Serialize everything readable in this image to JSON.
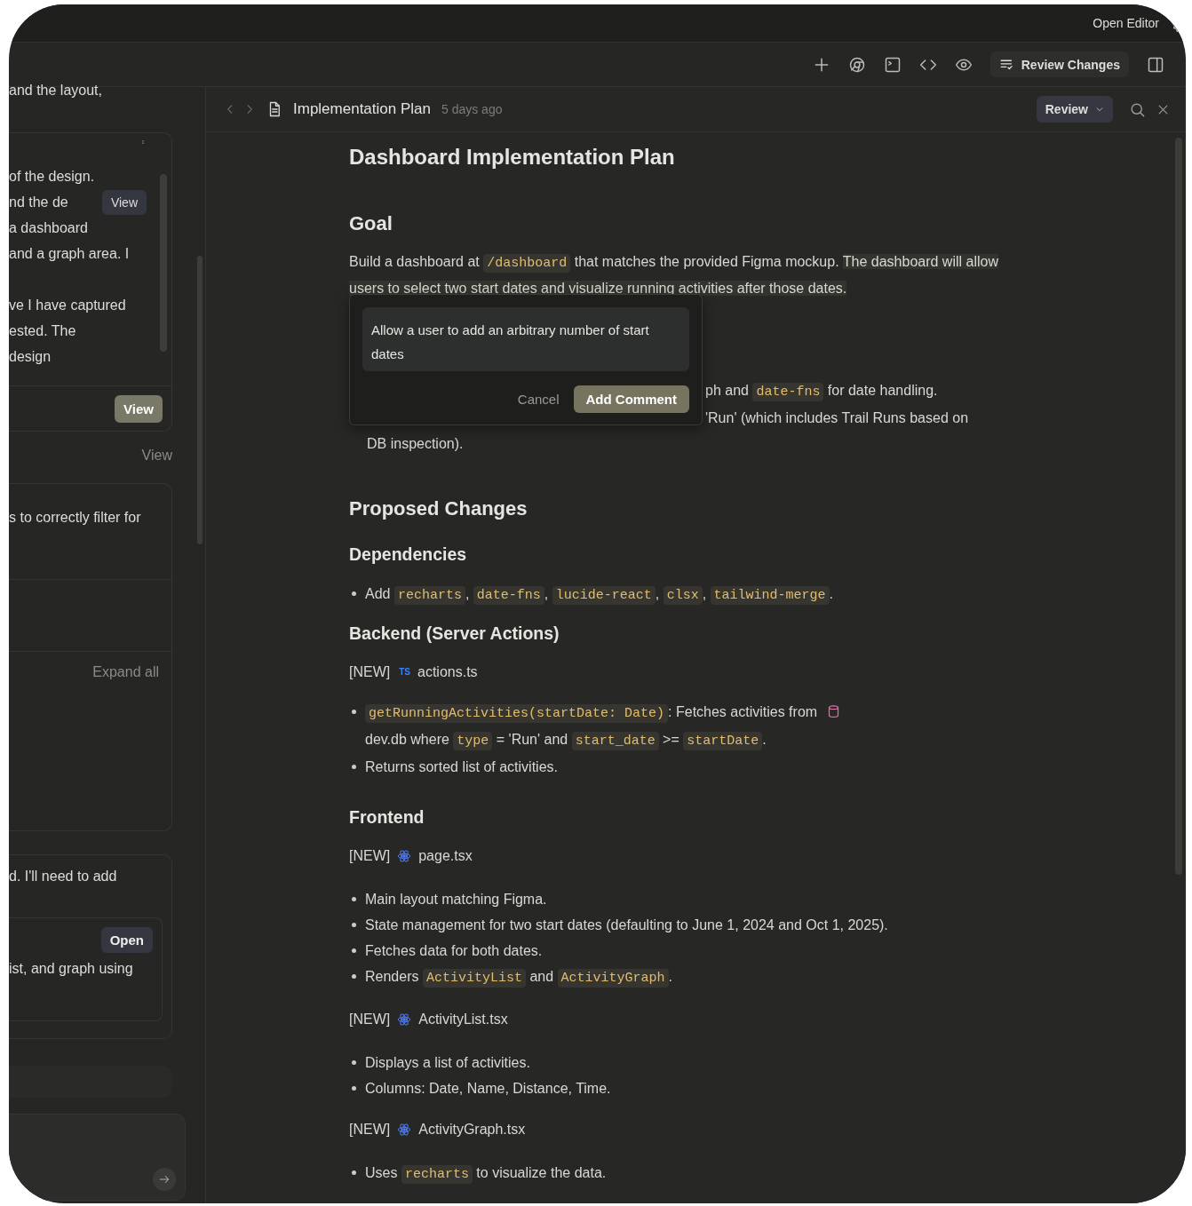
{
  "title_bar": {
    "open_editor": "Open Editor"
  },
  "toolbar": {
    "review_changes": "Review Changes"
  },
  "sidebar": {
    "top_text": "and the layout,",
    "card_lines": [
      {
        "text": "of the design."
      },
      {
        "text": "nd the de",
        "button": "View"
      },
      {
        "text": "a dashboard"
      },
      {
        "text": "and a graph area. I"
      },
      {
        "text": "ve I have captured"
      },
      {
        "text": "ested. The"
      },
      {
        "text": "design"
      }
    ],
    "card_button": "View",
    "view_link": "View",
    "filter_text": "s to correctly filter for",
    "expand_all": "Expand all",
    "need_text": "d. I'll need to add",
    "open_button": "Open",
    "graph_text": "ist, and graph using"
  },
  "document": {
    "title": "Implementation Plan",
    "age": "5 days ago",
    "review_button": "Review",
    "blocks": [
      {
        "kind": "h1",
        "segs": [
          {
            "kind": "text",
            "text": "Dashboard Implementation Plan"
          }
        ]
      },
      {
        "kind": "h2",
        "segs": [
          {
            "kind": "text",
            "text": "Goal"
          }
        ]
      },
      {
        "kind": "p",
        "segs": [
          {
            "kind": "text",
            "text": "Build a dashboard at "
          },
          {
            "kind": "code",
            "text": "/dashboard"
          },
          {
            "kind": "text",
            "text": " that matches the provided Figma mockup. "
          },
          {
            "kind": "highlight",
            "text": "The dashboard will allow users to select two start dates and visualize running activities after those dates."
          }
        ]
      },
      {
        "kind": "covered",
        "lines": [
          [
            {
              "kind": "text",
              "text": "ph and "
            },
            {
              "kind": "code",
              "text": "date-fns"
            },
            {
              "kind": "text",
              "text": " for date handling."
            }
          ],
          [
            {
              "kind": "text",
              "text": "'Run' (which includes Trail Runs based on"
            }
          ],
          [
            {
              "kind": "text",
              "text": "DB inspection)."
            }
          ]
        ]
      },
      {
        "kind": "h2",
        "segs": [
          {
            "kind": "text",
            "text": "Proposed Changes"
          }
        ]
      },
      {
        "kind": "h3",
        "segs": [
          {
            "kind": "text",
            "text": "Dependencies"
          }
        ]
      },
      {
        "kind": "bullets",
        "items": [
          [
            {
              "kind": "text",
              "text": "Add "
            },
            {
              "kind": "code",
              "text": "recharts"
            },
            {
              "kind": "text",
              "text": ", "
            },
            {
              "kind": "code",
              "text": "date-fns"
            },
            {
              "kind": "text",
              "text": ", "
            },
            {
              "kind": "code",
              "text": "lucide-react"
            },
            {
              "kind": "text",
              "text": ", "
            },
            {
              "kind": "code",
              "text": "clsx"
            },
            {
              "kind": "text",
              "text": ", "
            },
            {
              "kind": "code",
              "text": "tailwind-merge"
            },
            {
              "kind": "text",
              "text": "."
            }
          ]
        ]
      },
      {
        "kind": "h3",
        "segs": [
          {
            "kind": "text",
            "text": "Backend (Server Actions)"
          }
        ]
      },
      {
        "kind": "file",
        "tag": "[NEW]",
        "icon_text": "TS",
        "name": "actions.ts"
      },
      {
        "kind": "bullets",
        "items": [
          [
            {
              "kind": "code",
              "text": "getRunningActivities(startDate: Date)"
            },
            {
              "kind": "text",
              "text": ": Fetches activities from "
            },
            {
              "kind": "db",
              "text": "dev.db"
            },
            {
              "kind": "text",
              "text": " where "
            },
            {
              "kind": "code",
              "text": "type"
            },
            {
              "kind": "text",
              "text": " = 'Run' and "
            },
            {
              "kind": "code",
              "text": "start_date"
            },
            {
              "kind": "text",
              "text": " >= "
            },
            {
              "kind": "code",
              "text": "startDate"
            },
            {
              "kind": "text",
              "text": "."
            }
          ],
          [
            {
              "kind": "text",
              "text": "Returns sorted list of activities."
            }
          ]
        ]
      },
      {
        "kind": "h3",
        "segs": [
          {
            "kind": "text",
            "text": "Frontend"
          }
        ]
      },
      {
        "kind": "file",
        "tag": "[NEW]",
        "name": "page.tsx"
      },
      {
        "kind": "bullets",
        "items": [
          [
            {
              "kind": "text",
              "text": "Main layout matching Figma."
            }
          ],
          [
            {
              "kind": "text",
              "text": "State management for two start dates (defaulting to June 1, 2024 and Oct 1, 2025)."
            }
          ],
          [
            {
              "kind": "text",
              "text": "Fetches data for both dates."
            }
          ],
          [
            {
              "kind": "text",
              "text": "Renders "
            },
            {
              "kind": "code",
              "text": "ActivityList"
            },
            {
              "kind": "text",
              "text": " and "
            },
            {
              "kind": "code",
              "text": "ActivityGraph"
            },
            {
              "kind": "text",
              "text": "."
            }
          ]
        ]
      },
      {
        "kind": "file",
        "tag": "[NEW]",
        "name": "ActivityList.tsx"
      },
      {
        "kind": "bullets",
        "items": [
          [
            {
              "kind": "text",
              "text": "Displays a list of activities."
            }
          ],
          [
            {
              "kind": "text",
              "text": "Columns: Date, Name, Distance, Time."
            }
          ]
        ]
      },
      {
        "kind": "file",
        "tag": "[NEW]",
        "name": "ActivityGraph.tsx"
      },
      {
        "kind": "bullets",
        "items": [
          [
            {
              "kind": "text",
              "text": "Uses "
            },
            {
              "kind": "code",
              "text": "recharts"
            },
            {
              "kind": "text",
              "text": " to visualize the data."
            }
          ]
        ]
      }
    ]
  },
  "comment_popup": {
    "value": "Allow a user to add an arbitrary number of start dates",
    "cancel": "Cancel",
    "submit": "Add Comment"
  }
}
